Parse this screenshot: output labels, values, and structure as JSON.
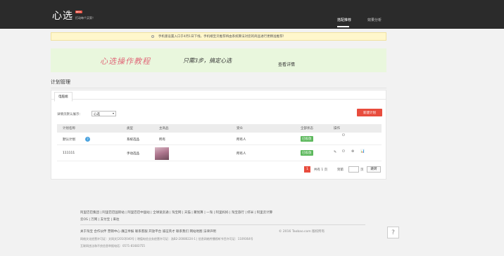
{
  "header": {
    "logo": "心选",
    "beta_badge": "BETA",
    "slogan": "打动每个买家！",
    "nav": [
      {
        "label": "搭配推荐",
        "active": true
      },
      {
        "label": "效果分析",
        "active": false
      }
    ]
  },
  "notice": {
    "text": "手机版设置入口于4月1日下线，手机端宝贝推荐将由系统算法对您的商品进行更精准推荐！"
  },
  "banner": {
    "title": "心选操作教程",
    "subtitle": "只需3步，搞定心选",
    "link": "查看详情"
  },
  "section": {
    "title": "计划管理",
    "tab": "电脑端",
    "show_label": "详情页默认展示：",
    "select_value": "心选",
    "new_plan_button": "新建计划"
  },
  "table": {
    "columns": [
      "计划名称",
      "类型",
      "主商品",
      "受众",
      "全部状态",
      "操作"
    ],
    "rows": [
      {
        "name": "默认计划",
        "type": "系统选品",
        "product": "所有",
        "audience": "所有人",
        "status": "已投放"
      },
      {
        "name": "111111",
        "type": "手动选品",
        "product": "",
        "audience": "所有人",
        "status": "已投放"
      }
    ]
  },
  "pagination": {
    "current": "1",
    "total_text": "共有 1 页",
    "goto_label": "到第",
    "page_suffix": "页",
    "confirm_button": "跳转"
  },
  "footer": {
    "links_line1": "阿里巴巴集团 | 阿里巴巴国际站 | 阿里巴巴中国站 | 全球速卖通 | 淘宝网 | 天猫 | 聚划算 | 一淘 | 阿里妈妈 | 淘宝旅行 | 虾米 | 阿里云计算",
    "links_line2": "云OS | 万网 | 支付宝 | 来往",
    "links_line3": "关于淘宝 合作伙伴 营销中心 廉正举报 联系客服 开放平台 诚征英才 联系我们 网站地图 法律声明",
    "copyright": "© 2016 Taobao.com 版权所有",
    "license": "网络文化经营许可证：文网文[2010]040号 | 增值电信业务经营许可证：浙B2-20080224-1 | 信息网络传播视听节目许可证：1109364号",
    "license2": "互联网违法和不良信息举报电话：0571-81683755",
    "help": "?"
  }
}
